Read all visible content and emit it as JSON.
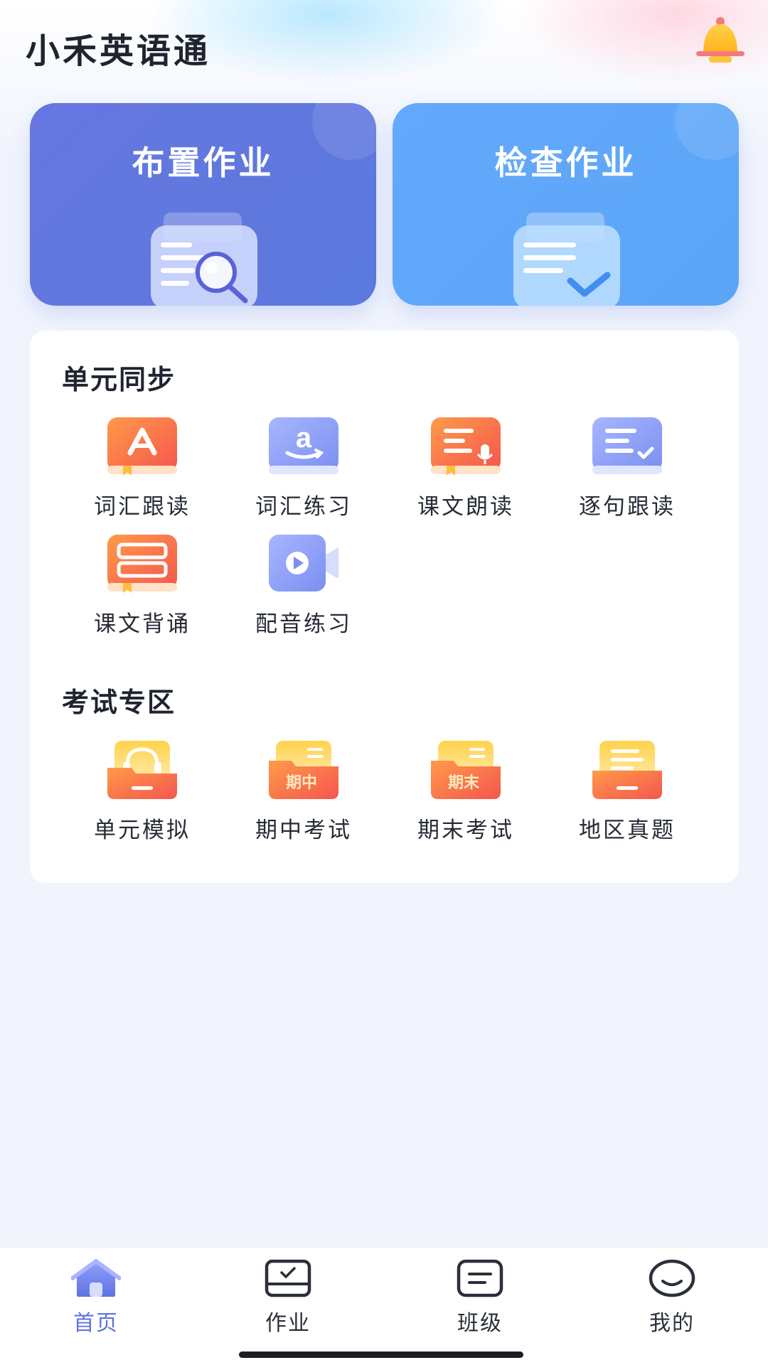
{
  "app": {
    "title": "小禾英语通",
    "accent_color": "#5d73e0"
  },
  "header": {
    "notification_icon": "bell-icon"
  },
  "hero_cards": [
    {
      "label": "布置作业",
      "icon": "document-search-icon",
      "color": "#6677e0"
    },
    {
      "label": "检查作业",
      "icon": "document-check-icon",
      "color": "#64a9fb"
    }
  ],
  "sections": {
    "unit_sync": {
      "title": "单元同步",
      "items": [
        {
          "label": "词汇跟读",
          "icon": "letter-a-book-icon"
        },
        {
          "label": "词汇练习",
          "icon": "letter-a-smile-icon"
        },
        {
          "label": "课文朗读",
          "icon": "text-microphone-icon"
        },
        {
          "label": "逐句跟读",
          "icon": "sentence-check-icon"
        },
        {
          "label": "课文背诵",
          "icon": "text-recite-icon"
        },
        {
          "label": "配音练习",
          "icon": "video-play-icon"
        }
      ]
    },
    "exam_zone": {
      "title": "考试专区",
      "items": [
        {
          "label": "单元模拟",
          "icon": "headphones-folder-icon"
        },
        {
          "label": "期中考试",
          "icon": "midterm-folder-icon",
          "badge": "期中"
        },
        {
          "label": "期末考试",
          "icon": "final-folder-icon",
          "badge": "期末"
        },
        {
          "label": "地区真题",
          "icon": "papers-folder-icon"
        }
      ]
    }
  },
  "tabbar": [
    {
      "label": "首页",
      "icon": "home-icon",
      "active": true
    },
    {
      "label": "作业",
      "icon": "homework-icon",
      "active": false
    },
    {
      "label": "班级",
      "icon": "class-icon",
      "active": false
    },
    {
      "label": "我的",
      "icon": "profile-icon",
      "active": false
    }
  ]
}
